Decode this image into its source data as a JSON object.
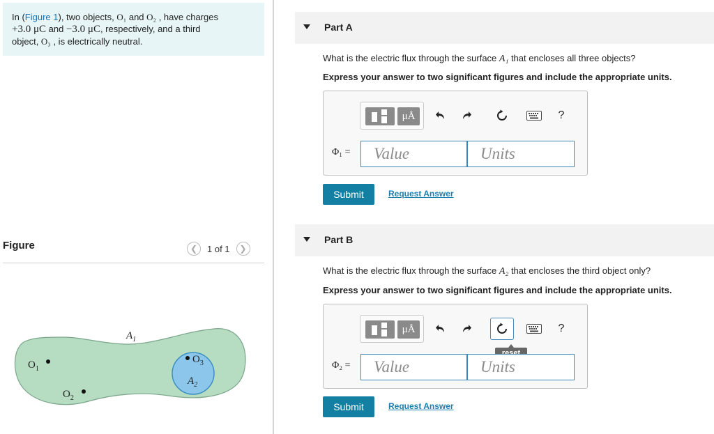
{
  "problem": {
    "intro_before": "In (",
    "figure_link": "Figure 1",
    "intro_mid1": "), two objects, ",
    "o1": "O₁",
    "and1": " and ",
    "o2": "O₂",
    "intro_mid2": " , have charges",
    "charge1": "+3.0 μC",
    "and2": " and ",
    "charge2": "−3.0 μC",
    "intro_mid3": ", respectively, and a third",
    "intro_line3a": "object, ",
    "o3": "O₃",
    "intro_end": " , is electrically neutral."
  },
  "figure": {
    "heading": "Figure",
    "counter": "1 of 1",
    "labels": {
      "o1": "O",
      "o1_sub": "1",
      "o2": "O",
      "o2_sub": "2",
      "o3": "O",
      "o3_sub": "3",
      "a1": "A",
      "a1_sub": "1",
      "a2": "A",
      "a2_sub": "2"
    },
    "colors": {
      "surface_fill": "#b6dcc2",
      "surface_stroke": "#7aa68a",
      "sphere_fill": "#8cc6ea",
      "sphere_stroke": "#3f8fc2"
    }
  },
  "parts": [
    {
      "title": "Part A",
      "question_pre": "What is the electric flux through the surface ",
      "surface": "A₁",
      "question_post": " that encloses all three objects?",
      "instruction": "Express your answer to two significant figures and include the appropriate units.",
      "symbol": "Φ₁ =",
      "value_placeholder": "Value",
      "units_placeholder": "Units",
      "submit_label": "Submit",
      "request_label": "Request Answer"
    },
    {
      "title": "Part B",
      "question_pre": "What is the electric flux through the surface ",
      "surface": "A₂",
      "question_post": " that encloses the third object only?",
      "instruction": "Express your answer to two significant figures and include the appropriate units.",
      "symbol": "Φ₂ =",
      "value_placeholder": "Value",
      "units_placeholder": "Units",
      "submit_label": "Submit",
      "request_label": "Request Answer",
      "tooltip": "reset"
    }
  ],
  "toolbar": {
    "units_label": "μÅ",
    "help_label": "?"
  },
  "theme": {
    "accent": "#127fa3",
    "link": "#1a7fb3",
    "intro_bg": "#e7f5f7",
    "part_bar_bg": "#f2f2f2"
  }
}
